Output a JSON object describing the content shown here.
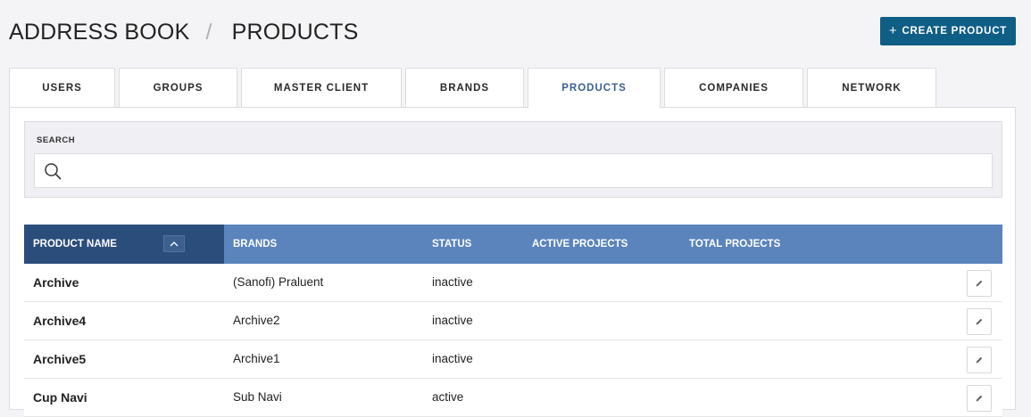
{
  "header": {
    "breadcrumb_root": "ADDRESS BOOK",
    "breadcrumb_separator": "/",
    "breadcrumb_current": "PRODUCTS",
    "create_button_icon": "plus-icon",
    "create_button_label": "CREATE PRODUCT"
  },
  "tabs": [
    {
      "label": "USERS"
    },
    {
      "label": "GROUPS"
    },
    {
      "label": "MASTER CLIENT"
    },
    {
      "label": "BRANDS"
    },
    {
      "label": "PRODUCTS",
      "active": true
    },
    {
      "label": "COMPANIES"
    },
    {
      "label": "NETWORK"
    }
  ],
  "search": {
    "label": "SEARCH",
    "value": "",
    "placeholder": ""
  },
  "table": {
    "columns": [
      "PRODUCT NAME",
      "BRANDS",
      "STATUS",
      "ACTIVE PROJECTS",
      "TOTAL PROJECTS"
    ],
    "sort_icon": "chevron-up-icon",
    "rows": [
      {
        "name": "Archive",
        "brands": "(Sanofi) Praluent",
        "status": "inactive",
        "active_projects": "",
        "total_projects": ""
      },
      {
        "name": "Archive4",
        "brands": "Archive2",
        "status": "inactive",
        "active_projects": "",
        "total_projects": ""
      },
      {
        "name": "Archive5",
        "brands": "Archive1",
        "status": "inactive",
        "active_projects": "",
        "total_projects": ""
      },
      {
        "name": "Cup Navi",
        "brands": "Sub Navi",
        "status": "active",
        "active_projects": "",
        "total_projects": ""
      }
    ]
  },
  "colors": {
    "primary_button": "#0f5e86",
    "table_header": "#5b84bd",
    "table_header_sorted": "#2b4d7c",
    "active_tab_text": "#3a5f96"
  }
}
